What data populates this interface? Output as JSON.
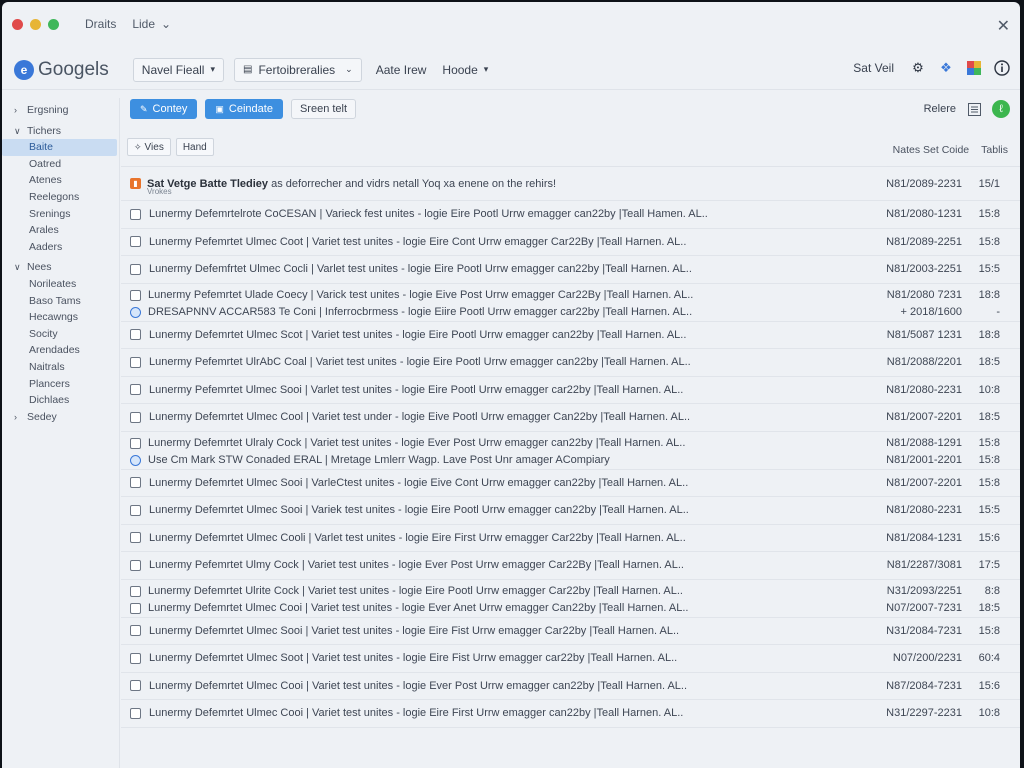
{
  "titlebar": {
    "title": "Draits",
    "menu": "Lide"
  },
  "appbar": {
    "logo": "Googels",
    "menus": [
      {
        "label": "Navel Fieall",
        "dropdown": true,
        "boxed": true
      },
      {
        "label": "Fertoibreralies",
        "dropdown": true,
        "boxed": true
      },
      {
        "label": "Aate Irew",
        "dropdown": false,
        "boxed": false
      },
      {
        "label": "Hoode",
        "dropdown": true,
        "boxed": false
      }
    ],
    "right_label": "Sat Veil"
  },
  "toolbar": {
    "primary_buttons": [
      "Contey",
      "Ceindate"
    ],
    "secondary_button": "Sreen telt",
    "right_label": "Relere"
  },
  "sidebar": {
    "sections": [
      {
        "label": "Ergsning",
        "chevron": "expand",
        "items": []
      },
      {
        "label": "Tichers",
        "chevron": "collapse",
        "items": [
          "Baite",
          "Oatred",
          "Atenes",
          "Reelegons",
          "Srenings",
          "Arales",
          "Aaders"
        ]
      },
      {
        "label": "Nees",
        "chevron": "collapse",
        "items": [
          "Norileates",
          "Baso Tams",
          "Hecawngs",
          "Socity",
          "Arendades",
          "Naitrals",
          "Plancers",
          "Dichlaes"
        ]
      },
      {
        "label": "Sedey",
        "chevron": "expand",
        "items": []
      }
    ],
    "active_item": "Baite"
  },
  "filters": {
    "chips": [
      "Vies",
      "Hand"
    ]
  },
  "columns": {
    "a": "Nates Set Coide",
    "b": "Tablis"
  },
  "header_message": {
    "bold": "Sat Vetge Batte Tlediey",
    "rest": "as deforrecher and vidrs netall Yoq xa enene on the rehirs!",
    "subline": "Vrokes",
    "date": "N81/2089-2231",
    "size": "15/1"
  },
  "messages": [
    {
      "subject": "Lunermy Defemrtelrote CoCESAN | Varieck fest unites - logie Eire Pootl Urrw emagger can22by |Teall Hamen. AL..",
      "date": "N81/2080-1231",
      "size": "15:8"
    },
    {
      "subject": "Lunermy Pefemrtet Ulmec Coot | Variet test unites - logie Eire Cont Urrw emagger Car22By |Teall Harnen. AL..",
      "date": "N81/2089-2251",
      "size": "15:8"
    },
    {
      "subject": "Lunermy Defemfrtet Ulmec Cocli | Varlet test unites - logie Eire Pootl Urrw emagger can22by |Teall Harnen. AL..",
      "date": "N81/2003-2251",
      "size": "15:5"
    },
    {
      "pair": true,
      "subject": "Lunermy Pefemrtet Ulade Coecy | Varick test unites - logie Eive Post Urrw emagger Car22By |Teall Harnen. AL..",
      "date": "N81/2080 7231",
      "size": "18:8",
      "subject2": "DRESAPNNV ACCAR583 Te Coni | Inferrocbrmess - logie Eiire Pootl Urrw emagger car22by |Teall Harnen. AL..",
      "date2": "+ 2018/1600",
      "size2": "-"
    },
    {
      "subject": "Lunermy Defemrtet Ulmec Scot | Variet test unites - logie Eire Pootl Urrw emagger can22by |Teall Harnen. AL..",
      "date": "N81/5087 1231",
      "size": "18:8"
    },
    {
      "subject": "Lunermy Pefemrtet UlrAbC Coal | Variet test unites - logie Eire Pootl Urrw emagger can22by |Teall Harnen. AL..",
      "date": "N81/2088/2201",
      "size": "18:5"
    },
    {
      "subject": "Lunermy Pefemrtet Ulmec Sooi | Varlet test unites - logie Eire Pootl Urrw emagger car22by |Teall Harnen. AL..",
      "date": "N81/2080-2231",
      "size": "10:8"
    },
    {
      "subject": "Lunermy Defemrtet Ulmec Cool | Variet test under - logie Eive Pootl Urrw emagger Can22by |Teall Harnen. AL..",
      "date": "N81/2007-2201",
      "size": "18:5"
    },
    {
      "pair": true,
      "second_square": false,
      "subject": "Lunermy Defemrtet Ulraly Cock | Variet test unites - logie Ever Post Urrw emagger can22by |Teall Harnen. AL..",
      "date": "N81/2088-1291",
      "size": "15:8",
      "subject2": "Use Cm Mark STW Conaded ERAL | Mretage Lmlerr Wagp. Lave Post Unr amager ACompiary",
      "date2": "N81/2001-2201",
      "size2": "15:8"
    },
    {
      "subject": "Lunermy Defemrtet Ulmec Sooi | VarleCtest unites - logie Eive Cont Urrw emagger can22by |Teall Harnen. AL..",
      "date": "N81/2007-2201",
      "size": "15:8"
    },
    {
      "subject": "Lunermy Defemrtet Ulmec Sooi | Variek test unites - logie Eire Pootl Urrw emagger can22by |Teall Harnen. AL..",
      "date": "N81/2080-2231",
      "size": "15:5"
    },
    {
      "subject": "Lunermy Defemrtet Ulmec Cooli | Varlet test unites - logie Eire First Urrw emagger Car22by |Teall Harnen. AL..",
      "date": "N81/2084-1231",
      "size": "15:6"
    },
    {
      "subject": "Lunermy Pefemrtet Ulmy Cock | Variet test unites - logie Ever Post Urrw emagger Car22By |Teall Harnen. AL..",
      "date": "N81/2287/3081",
      "size": "17:5"
    },
    {
      "pair": true,
      "second_square": true,
      "subject": "Lunermy Defemrtet Ulrite Cock | Variet test unites - logie Eire Pootl Urrw emagger Car22by |Teall Harnen. AL..",
      "date": "N31/2093/2251",
      "size": "8:8",
      "subject2": "Lunermy Defemrtet Ulmec Cooi | Variet test unites - logie Ever Anet Urrw emagger Can22by |Teall Harnen. AL..",
      "date2": "N07/2007-7231",
      "size2": "18:5"
    },
    {
      "subject": "Lunermy Defemrtet Ulmec Sooi | Variet test unites - logie Eire Fist Urrw emagger Car22by |Teall Harnen. AL..",
      "date": "N31/2084-7231",
      "size": "15:8"
    },
    {
      "subject": "Lunermy Defemrtet Ulmec Soot | Variet test unites - logie Eire Fist Urrw emagger car22by |Teall Harnen. AL..",
      "date": "N07/200/2231",
      "size": "60:4"
    },
    {
      "subject": "Lunermy Defemrtet Ulmec Cooi | Variet test unites - logie Ever Post Urrw emagger can22by |Teall Harnen. AL..",
      "date": "N87/2084-7231",
      "size": "15:6"
    },
    {
      "subject": "Lunermy Defemrtet Ulmec Cooi | Variet test unites - logie Eire First Urrw emagger can22by |Teall Harnen. AL..",
      "date": "N31/2297-2231",
      "size": "10:8"
    }
  ]
}
